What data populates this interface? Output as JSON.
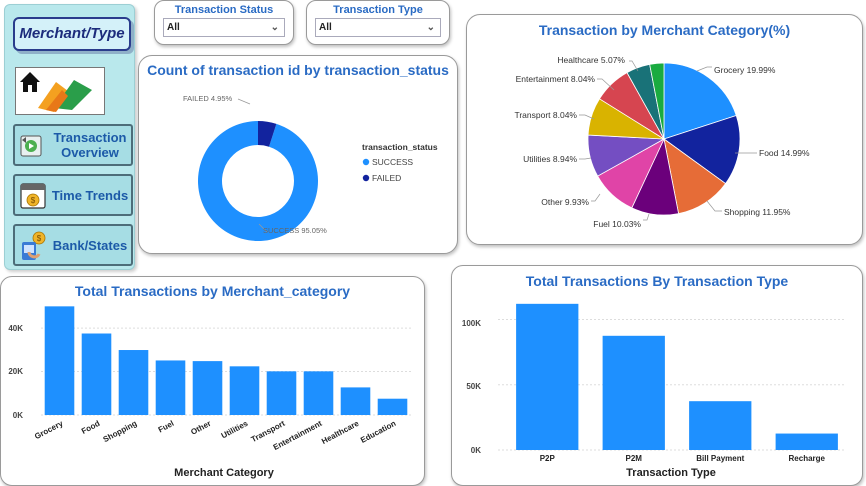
{
  "sidebar": {
    "merchant_type_label": "Merchant/Type",
    "nav": [
      {
        "label": "Transaction Overview",
        "icon": "transaction-icon"
      },
      {
        "label": "Time Trends",
        "icon": "calendar-icon"
      },
      {
        "label": "Bank/States",
        "icon": "bank-icon"
      }
    ],
    "logo_icon": "home-logo-icon"
  },
  "slicers": {
    "status": {
      "label": "Transaction Status",
      "value": "All"
    },
    "type": {
      "label": "Transaction Type",
      "value": "All"
    }
  },
  "donut": {
    "title": "Count of transaction id by transaction_status",
    "legend_title": "transaction_status",
    "failed_label": "FAILED 4.95%",
    "success_label": "SUCCESS 95.05%",
    "legend": [
      "SUCCESS",
      "FAILED"
    ]
  },
  "pie": {
    "title": "Transaction by Merchant Category(%)",
    "labels": [
      "Grocery 19.99%",
      "Food 14.99%",
      "Shopping 11.95%",
      "Fuel 10.03%",
      "Other 9.93%",
      "Utilities 8.94%",
      "Transport 8.04%",
      "Entertainment 8.04%",
      "Healthcare 5.07%"
    ]
  },
  "merchant_bar": {
    "title": "Total Transactions by Merchant_category",
    "xlabel": "Merchant Category",
    "yticks": [
      "40K",
      "20K",
      "0K"
    ]
  },
  "type_bar": {
    "title": "Total Transactions By Transaction Type",
    "xlabel": "Transaction Type",
    "yticks": [
      "100K",
      "50K",
      "0K"
    ]
  },
  "colors": {
    "accent": "#1e90ff",
    "success": "#1e90ff",
    "failed": "#12239e",
    "title": "#2a6bc4"
  },
  "chart_data": [
    {
      "type": "pie",
      "title": "Count of transaction id by transaction_status",
      "donut": true,
      "categories": [
        "SUCCESS",
        "FAILED"
      ],
      "values": [
        95.05,
        4.95
      ],
      "colors": [
        "#1e90ff",
        "#12239e"
      ],
      "legend_title": "transaction_status",
      "legend_position": "right"
    },
    {
      "type": "pie",
      "title": "Transaction by Merchant Category(%)",
      "categories": [
        "Grocery",
        "Food",
        "Shopping",
        "Fuel",
        "Other",
        "Utilities",
        "Transport",
        "Entertainment",
        "Healthcare",
        "Education"
      ],
      "values": [
        19.99,
        14.99,
        11.95,
        10.03,
        9.93,
        8.94,
        8.04,
        8.04,
        5.07,
        3.02
      ],
      "colors": [
        "#1e90ff",
        "#12239e",
        "#e66c37",
        "#6b007b",
        "#e044a7",
        "#744ec2",
        "#d9b300",
        "#d64550",
        "#197278",
        "#1aab40"
      ]
    },
    {
      "type": "bar",
      "title": "Total Transactions by Merchant_category",
      "xlabel": "Merchant Category",
      "ylabel": "",
      "categories": [
        "Grocery",
        "Food",
        "Shopping",
        "Fuel",
        "Other",
        "Utilities",
        "Transport",
        "Entertainment",
        "Healthcare",
        "Education"
      ],
      "values": [
        50000,
        37500,
        29900,
        25100,
        24800,
        22400,
        20100,
        20100,
        12700,
        7500
      ],
      "ylim": [
        0,
        52000
      ],
      "grid": true
    },
    {
      "type": "bar",
      "title": "Total Transactions By Transaction Type",
      "xlabel": "Transaction Type",
      "ylabel": "",
      "categories": [
        "P2P",
        "P2M",
        "Bill Payment",
        "Recharge"
      ],
      "values": [
        112000,
        87500,
        37400,
        12600
      ],
      "ylim": [
        0,
        118000
      ],
      "grid": true
    }
  ]
}
